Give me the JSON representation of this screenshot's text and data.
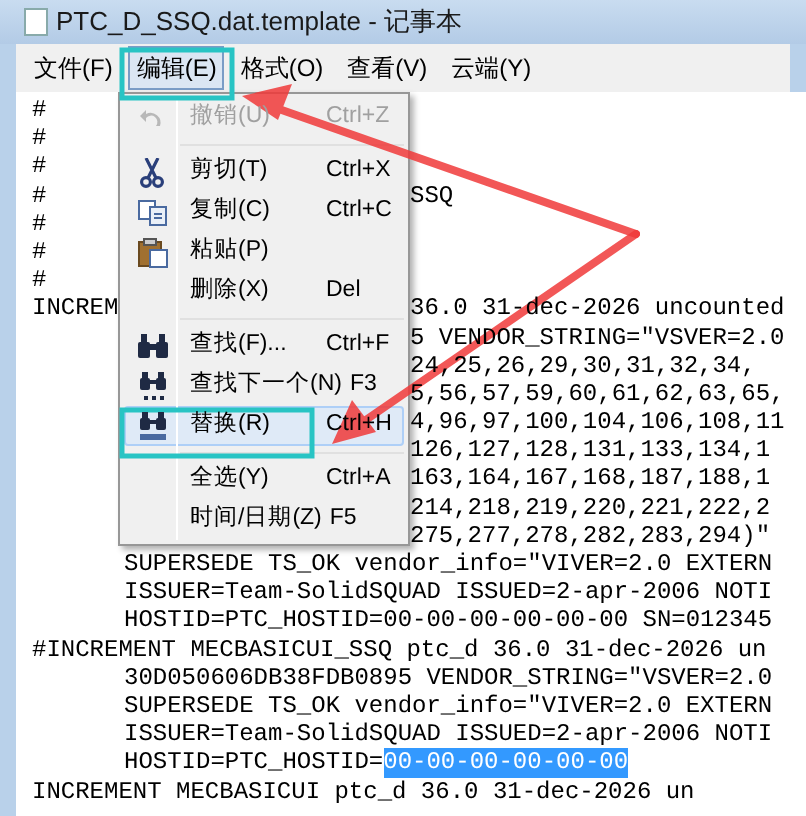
{
  "window": {
    "title": "PTC_D_SSQ.dat.template - 记事本"
  },
  "menubar": [
    {
      "label": "文件(F)",
      "selected": false
    },
    {
      "label": "编辑(E)",
      "selected": true
    },
    {
      "label": "格式(O)",
      "selected": false
    },
    {
      "label": "查看(V)",
      "selected": false
    },
    {
      "label": "云端(Y)",
      "selected": false
    }
  ],
  "edit_menu": [
    {
      "kind": "item",
      "label": "撤销(U)",
      "shortcut": "Ctrl+Z",
      "disabled": true,
      "highlighted": false
    },
    {
      "kind": "separator"
    },
    {
      "kind": "item",
      "label": "剪切(T)",
      "shortcut": "Ctrl+X",
      "disabled": false,
      "highlighted": false
    },
    {
      "kind": "item",
      "label": "复制(C)",
      "shortcut": "Ctrl+C",
      "disabled": false,
      "highlighted": false
    },
    {
      "kind": "item",
      "label": "粘贴(P)",
      "disabled": false,
      "highlighted": false
    },
    {
      "kind": "item",
      "label": "删除(X)",
      "shortcut": "Del",
      "disabled": false,
      "highlighted": false
    },
    {
      "kind": "separator"
    },
    {
      "kind": "item",
      "label": "查找(F)...",
      "shortcut": "Ctrl+F",
      "disabled": false,
      "highlighted": false
    },
    {
      "kind": "item",
      "label": "查找下一个(N)",
      "shortcut": "F3",
      "disabled": false,
      "highlighted": false
    },
    {
      "kind": "item",
      "label": "替换(R)",
      "shortcut": "Ctrl+H",
      "disabled": false,
      "highlighted": true
    },
    {
      "kind": "separator"
    },
    {
      "kind": "item",
      "label": "全选(Y)",
      "shortcut": "Ctrl+A",
      "disabled": false,
      "highlighted": false
    },
    {
      "kind": "item",
      "label": "时间/日期(Z)",
      "shortcut": "F5",
      "disabled": false,
      "highlighted": false
    }
  ],
  "lines": [
    {
      "text": "#"
    },
    {
      "text": "#"
    },
    {
      "text": "#"
    },
    {
      "text": "#",
      "tail": "SSQ"
    },
    {
      "text": "#"
    },
    {
      "text": "#"
    },
    {
      "text": "#"
    },
    {
      "text": "INCREM",
      "tail": "36.0 31-dec-2026 uncounted"
    },
    {
      "tail": "5 VENDOR_STRING=\"VSVER=2.0"
    },
    {
      "tail": "24,25,26,29,30,31,32,34,"
    },
    {
      "tail": "5,56,57,59,60,61,62,63,65,"
    },
    {
      "tail": "4,96,97,100,104,106,108,11"
    },
    {
      "tail": "126,127,128,131,133,134,1"
    },
    {
      "tail": "163,164,167,168,187,188,1"
    },
    {
      "tail": "214,218,219,220,221,222,2"
    },
    {
      "tail": "275,277,278,282,283,294)\""
    },
    {
      "indented": true,
      "text": "SUPERSEDE TS_OK vendor_info=\"VIVER=2.0 EXTERN"
    },
    {
      "indented": true,
      "text": "ISSUER=Team-SolidSQUAD ISSUED=2-apr-2006 NOTI"
    },
    {
      "indented": true,
      "text": "HOSTID=PTC_HOSTID=00-00-00-00-00-00 SN=012345"
    },
    {
      "indented": false,
      "text": "#INCREMENT MECBASICUI_SSQ ptc_d 36.0 31-dec-2026 un"
    },
    {
      "indented": true,
      "text": "30D050606DB38FDB0895 VENDOR_STRING=\"VSVER=2.0"
    },
    {
      "indented": true,
      "text": "SUPERSEDE TS_OK vendor_info=\"VIVER=2.0 EXTERN"
    },
    {
      "indented": true,
      "text": "ISSUER=Team-SolidSQUAD ISSUED=2-apr-2006 NOTI"
    },
    {
      "indented": true,
      "text": "HOSTID=PTC_HOSTID=",
      "selection": "00-00-00-00-00-00"
    },
    {
      "indented": false,
      "text": "INCREMENT MECBASICUI ptc_d 36.0 31-dec-2026 un"
    }
  ]
}
